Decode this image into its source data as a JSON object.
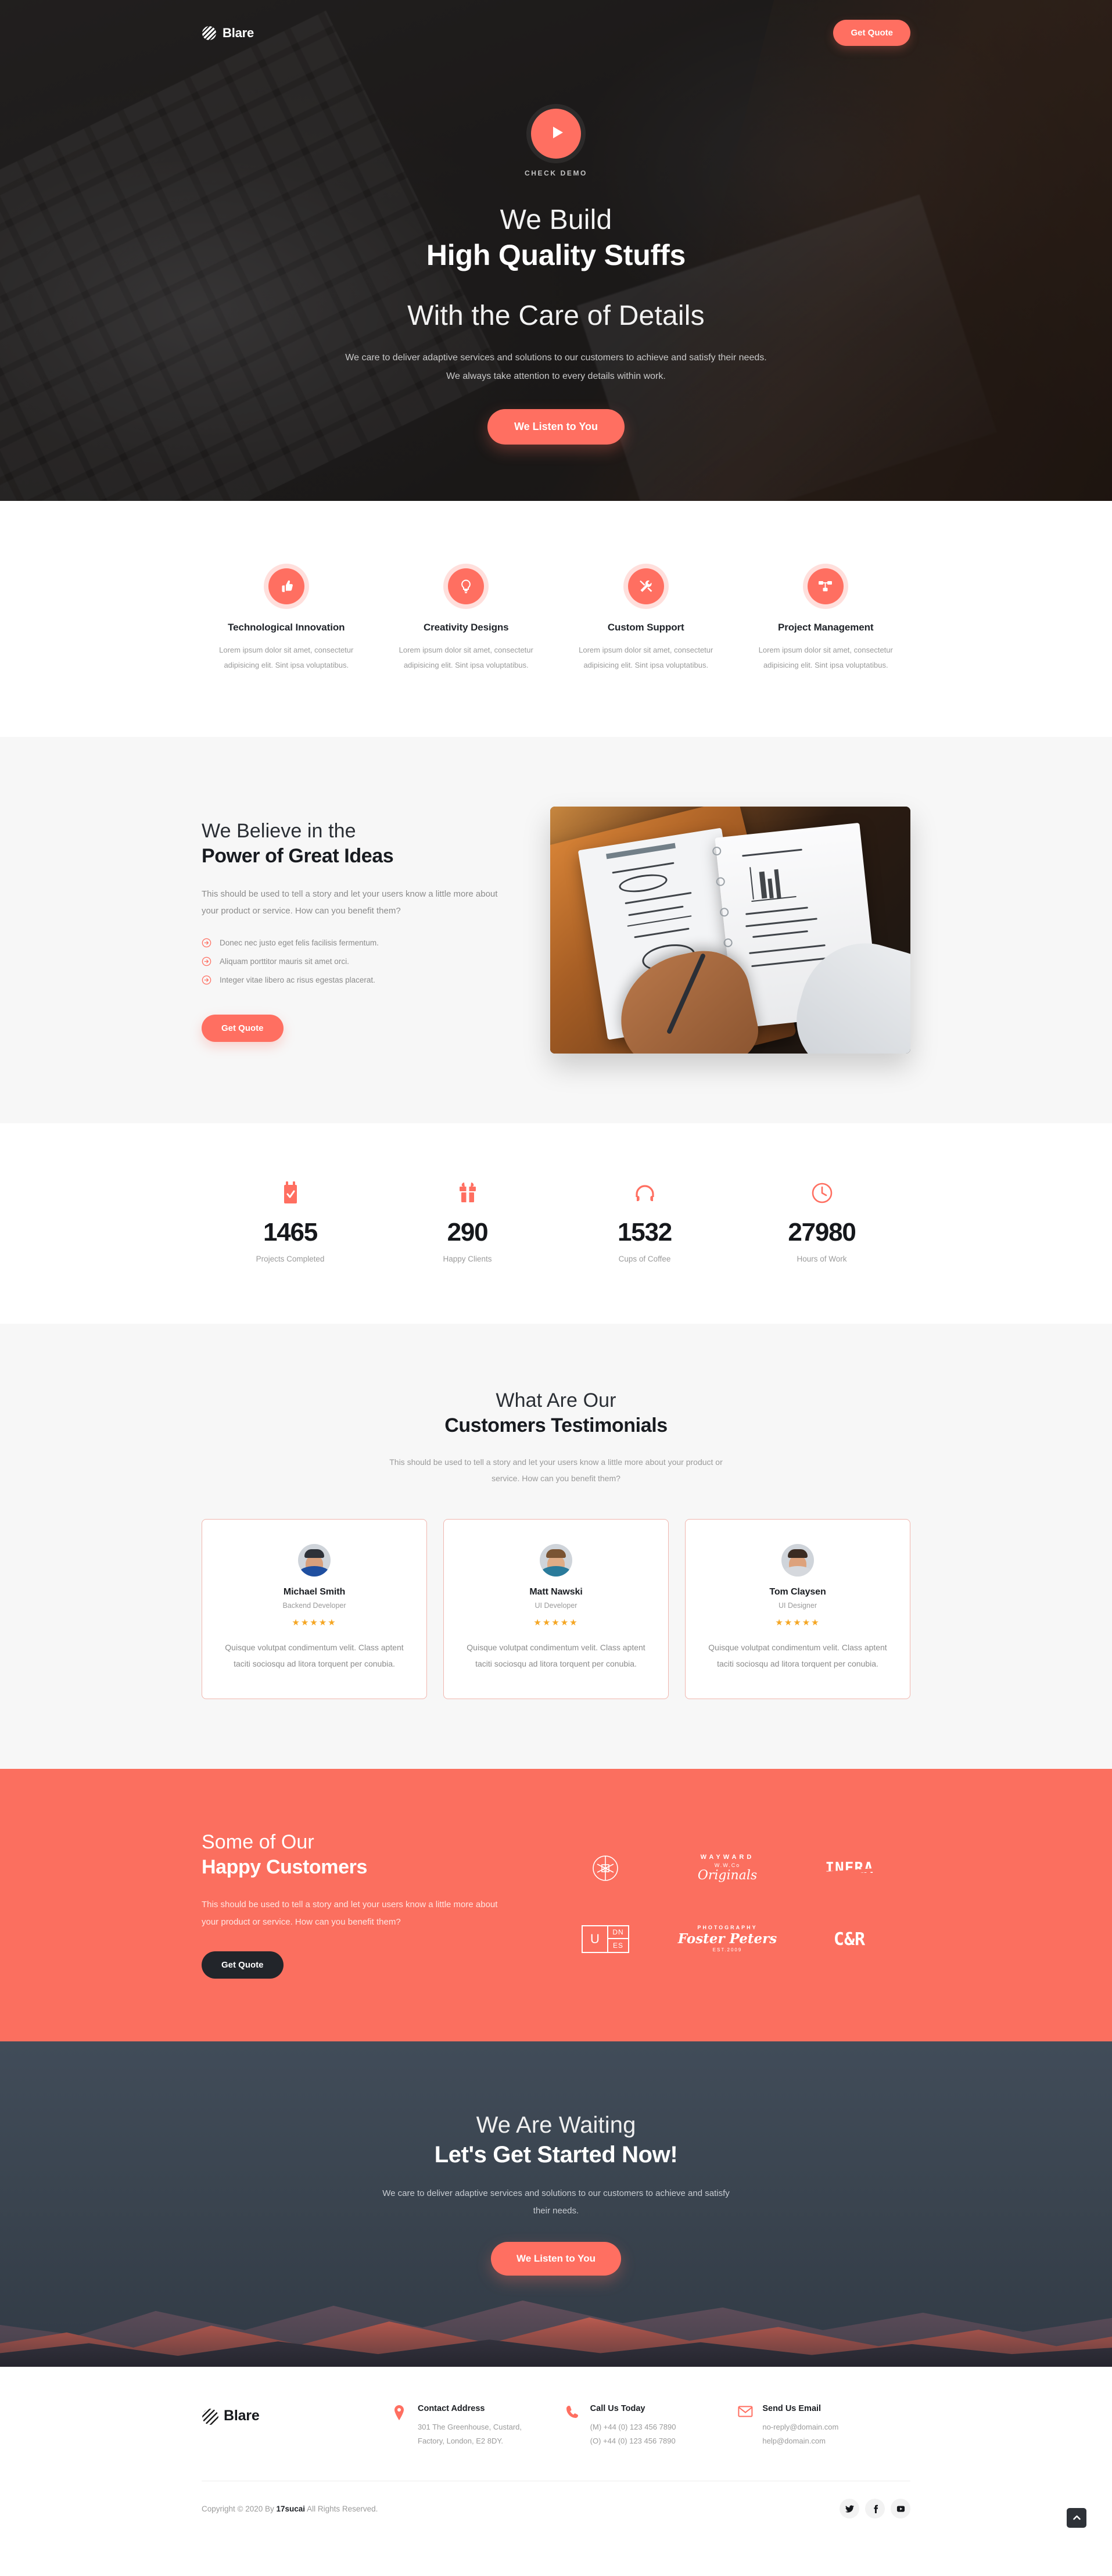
{
  "brand": {
    "name": "Blare",
    "mark_icon": "blare-sphere-logo"
  },
  "nav": {
    "cta_label": "Get Quote"
  },
  "hero": {
    "play_icon": "play-icon",
    "demo_label": "CHECK DEMO",
    "title_light": "We Build",
    "title_bold": "High Quality Stuffs",
    "title_light2": "With the Care of Details",
    "paragraph": "We care to deliver adaptive services and solutions to our customers to achieve and satisfy their needs. We always take attention to every details within work.",
    "cta_label": "We Listen to You"
  },
  "features": [
    {
      "icon": "thumbs-up-icon",
      "title": "Technological Innovation",
      "text": "Lorem ipsum dolor sit amet, consectetur adipisicing elit. Sint ipsa voluptatibus."
    },
    {
      "icon": "lightbulb-icon",
      "title": "Creativity Designs",
      "text": "Lorem ipsum dolor sit amet, consectetur adipisicing elit. Sint ipsa voluptatibus."
    },
    {
      "icon": "tools-icon",
      "title": "Custom Support",
      "text": "Lorem ipsum dolor sit amet, consectetur adipisicing elit. Sint ipsa voluptatibus."
    },
    {
      "icon": "sitemap-icon",
      "title": "Project Management",
      "text": "Lorem ipsum dolor sit amet, consectetur adipisicing elit. Sint ipsa voluptatibus."
    }
  ],
  "believe": {
    "title_light": "We Believe in the",
    "title_bold": "Power of Great Ideas",
    "paragraph": "This should be used to tell a story and let your users know a little more about your product or service. How can you benefit them?",
    "bullets": [
      "Donec nec justo eget felis facilisis fermentum.",
      "Aliquam porttitor mauris sit amet orci.",
      "Integer vitae libero ac risus egestas placerat."
    ],
    "bullet_icon": "arrow-right-circle-icon",
    "cta_label": "Get Quote",
    "image_alt": "hand-writing-in-notebook-photo"
  },
  "stats": [
    {
      "icon": "calendar-check-icon",
      "value": "1465",
      "label": "Projects Completed"
    },
    {
      "icon": "gift-icon",
      "value": "290",
      "label": "Happy Clients"
    },
    {
      "icon": "headphones-icon",
      "value": "1532",
      "label": "Cups of Coffee"
    },
    {
      "icon": "clock-icon",
      "value": "27980",
      "label": "Hours of Work"
    }
  ],
  "testimonials": {
    "title_light": "What Are Our",
    "title_bold": "Customers Testimonials",
    "subtitle": "This should be used to tell a story and let your users know a little more about your product or service. How can you benefit them?",
    "items": [
      {
        "avatar": "man-in-beanie-avatar",
        "name": "Michael Smith",
        "role": "Backend Developer",
        "stars": "★★★★★",
        "quote": "Quisque volutpat condimentum velit. Class aptent taciti sociosqu ad litora torquent per conubia."
      },
      {
        "avatar": "man-in-blue-shirt-avatar",
        "name": "Matt Nawski",
        "role": "UI Developer",
        "stars": "★★★★★",
        "quote": "Quisque volutpat condimentum velit. Class aptent taciti sociosqu ad litora torquent per conubia."
      },
      {
        "avatar": "bearded-man-avatar",
        "name": "Tom Claysen",
        "role": "UI Designer",
        "stars": "★★★★★",
        "quote": "Quisque volutpat condimentum velit. Class aptent taciti sociosqu ad litora torquent per conubia."
      }
    ]
  },
  "clients": {
    "title_light": "Some of Our",
    "title_bold": "Happy Customers",
    "paragraph": "This should be used to tell a story and let your users know a little more about your product or service. How can you benefit them?",
    "cta_label": "Get Quote",
    "logos": [
      {
        "id": "aperture-logo",
        "text": ""
      },
      {
        "id": "wayward-originals-logo",
        "arc": "WAYWARD",
        "small": "W.W.Co",
        "script": "Originals"
      },
      {
        "id": "infra-logo",
        "text": "INFRA"
      },
      {
        "id": "udnes-logo",
        "u": "U",
        "d": "DN",
        "e": "ES"
      },
      {
        "id": "foster-peters-logo",
        "top": "PHOTOGRAPHY",
        "mid": "Foster Peters",
        "bot": "EST.2009"
      },
      {
        "id": "cr-logo",
        "text": "C&R"
      }
    ]
  },
  "cta": {
    "title_light": "We Are Waiting",
    "title_bold": "Let's Get Started Now!",
    "paragraph": "We care to deliver adaptive services and solutions to our customers to achieve and satisfy their needs.",
    "button_label": "We Listen to You"
  },
  "footer": {
    "contacts": [
      {
        "icon": "map-pin-icon",
        "title": "Contact Address",
        "line1": "301 The Greenhouse, Custard,",
        "line2": "Factory, London, E2 8DY."
      },
      {
        "icon": "phone-icon",
        "title": "Call Us Today",
        "line1": "(M) +44 (0) 123 456 7890",
        "line2": "(O) +44 (0) 123 456 7890"
      },
      {
        "icon": "envelope-icon",
        "title": "Send Us Email",
        "line1": "no-reply@domain.com",
        "line2": "help@domain.com"
      }
    ],
    "copyright_pre": "Copyright © 2020 By ",
    "copyright_brand": "17sucai",
    "copyright_post": " All Rights Reserved.",
    "socials": [
      {
        "id": "twitter-icon"
      },
      {
        "id": "facebook-icon"
      },
      {
        "id": "youtube-icon"
      }
    ],
    "to_top_icon": "chevron-up-icon"
  },
  "colors": {
    "accent": "#ff6f61",
    "coral_section": "#fb6f5f",
    "dark": "#22252a",
    "star": "#f5a623"
  }
}
